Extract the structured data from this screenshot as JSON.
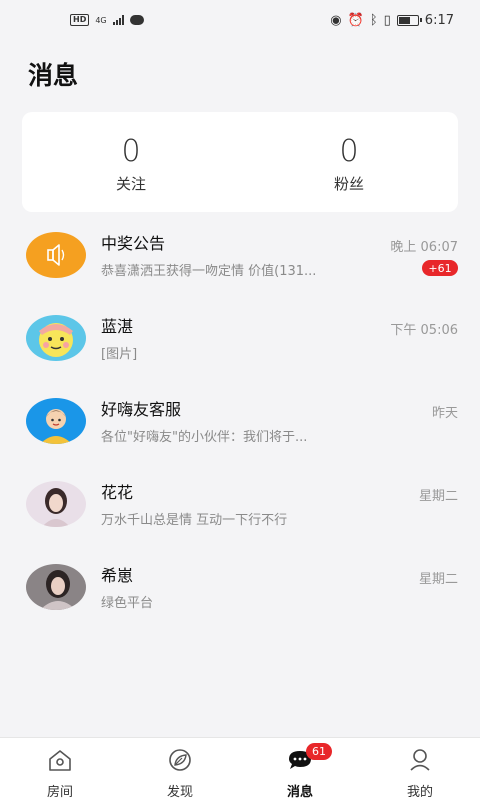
{
  "status_bar": {
    "left_icons": [
      "hd-icon",
      "4g-signal-icon",
      "chat-bubble-icon"
    ],
    "hd_label": "HD",
    "signal_label": "4G",
    "right_icons": [
      "eye-icon",
      "alarm-icon",
      "bluetooth-icon",
      "vibrate-icon",
      "battery-icon"
    ],
    "battery_level": 0.6,
    "time": "6:17"
  },
  "header": {
    "title": "消息"
  },
  "stats": [
    {
      "count": "0",
      "label": "关注"
    },
    {
      "count": "0",
      "label": "粉丝"
    }
  ],
  "messages": [
    {
      "name": "中奖公告",
      "preview": "恭喜潇洒王获得一吻定情 价值(131...",
      "time": "晚上 06:07",
      "badge": "+61",
      "avatar": "speaker-icon",
      "avatar_color": "#f5a020"
    },
    {
      "name": "蓝湛",
      "preview": "[图片]",
      "time": "下午 05:06",
      "avatar": "cartoon-avatar"
    },
    {
      "name": "好嗨友客服",
      "preview": "各位\"好嗨友\"的小伙伴：我们将于...",
      "time": "昨天",
      "avatar": "customer-service-avatar",
      "avatar_color": "#1a96e8"
    },
    {
      "name": "花花",
      "preview": "万水千山总是情 互动一下行不行",
      "time": "星期二",
      "avatar": "photo-avatar"
    },
    {
      "name": "希崽",
      "preview": "绿色平台",
      "time": "星期二",
      "avatar": "photo-avatar"
    }
  ],
  "bottom_nav": [
    {
      "label": "房间",
      "icon": "house-icon"
    },
    {
      "label": "发现",
      "icon": "compass-leaf-icon"
    },
    {
      "label": "消息",
      "icon": "chat-bubble-icon",
      "badge": "61",
      "active": true
    },
    {
      "label": "我的",
      "icon": "person-icon"
    }
  ],
  "colors": {
    "badge": "#e8272a",
    "accent_orange": "#f5a020",
    "accent_blue": "#1a96e8",
    "background": "#f4f4f6"
  }
}
